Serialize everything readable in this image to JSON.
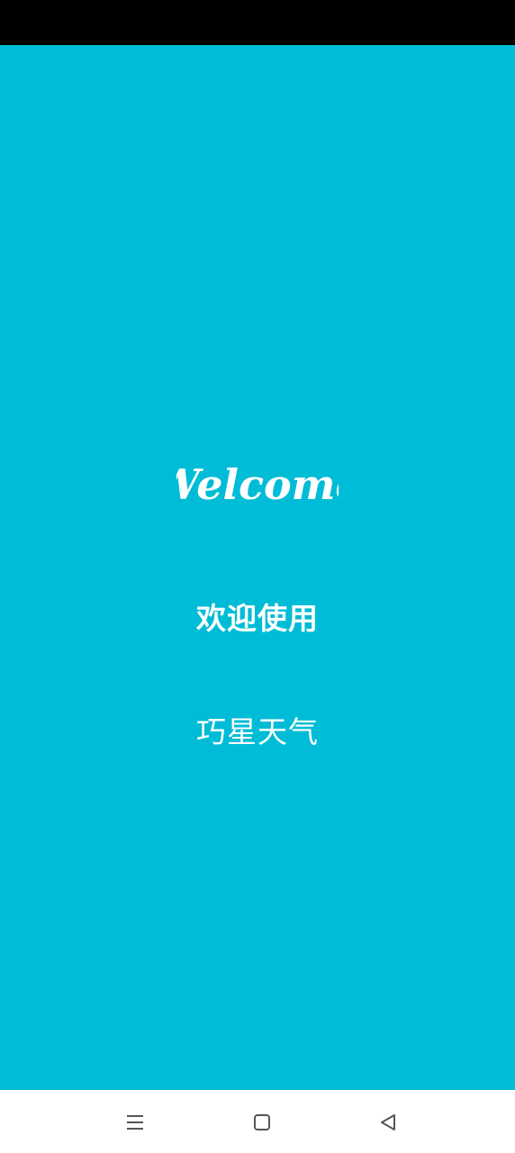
{
  "welcome_logo": "Welcome",
  "greeting": "欢迎使用",
  "app_name": "巧星天气",
  "colors": {
    "background": "#00BCD6",
    "status_bar": "#000000",
    "nav_bar": "#FFFFFF",
    "nav_icon": "#555555",
    "text": "#FFFFFF"
  },
  "nav": {
    "menu_icon": "menu-icon",
    "home_icon": "home-icon",
    "back_icon": "back-icon"
  }
}
